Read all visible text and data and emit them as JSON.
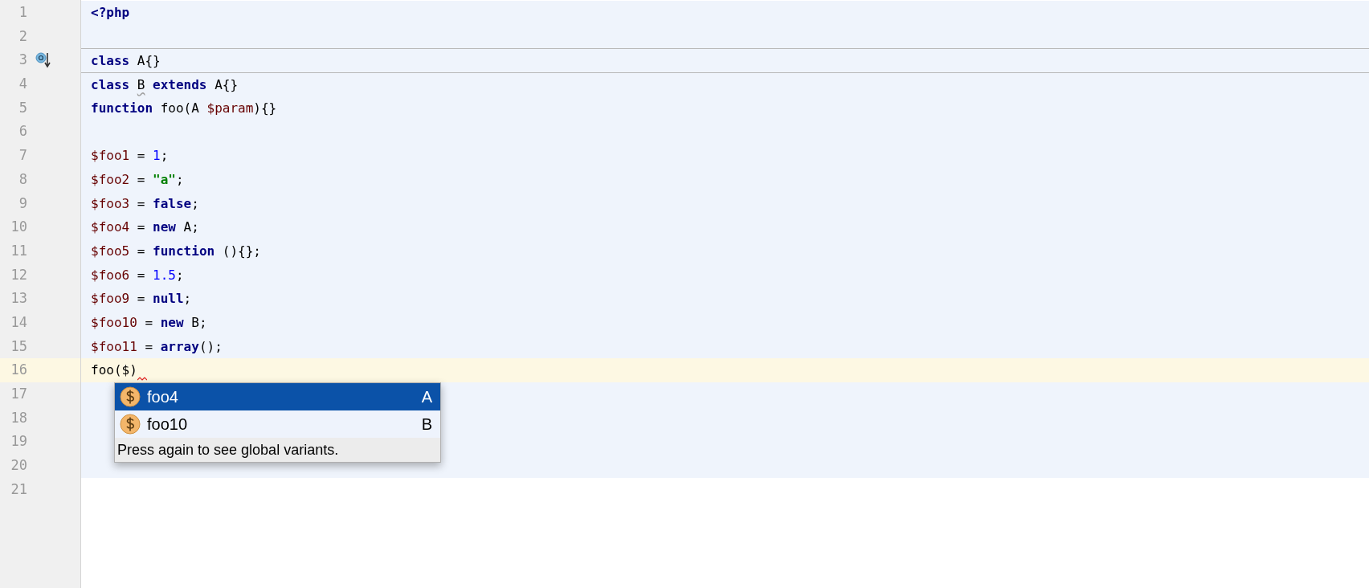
{
  "editor": {
    "lines": [
      {
        "number": "1",
        "tinted": true,
        "current": false,
        "separator_above": false,
        "error_after": false,
        "tokens": [
          {
            "kind": "keyword",
            "text": "<?php"
          }
        ]
      },
      {
        "number": "2",
        "tinted": true,
        "current": false,
        "separator_above": false,
        "error_after": false
      },
      {
        "number": "3",
        "tinted": true,
        "current": false,
        "separator_above": true,
        "error_after": false,
        "gutter_marker": {
          "kind": "implemented"
        },
        "tokens": [
          {
            "kind": "keyword",
            "text": "class"
          },
          {
            "kind": "plain",
            "text": " A{}"
          }
        ]
      },
      {
        "number": "4",
        "tinted": true,
        "current": false,
        "separator_above": true,
        "error_after": false,
        "tokens": [
          {
            "kind": "keyword",
            "text": "class "
          },
          {
            "kind": "warning",
            "text": "B"
          },
          {
            "kind": "keyword",
            "text": " extends"
          },
          {
            "kind": "plain",
            "text": " A{}"
          }
        ]
      },
      {
        "number": "5",
        "tinted": true,
        "current": false,
        "separator_above": false,
        "error_after": false,
        "tokens": [
          {
            "kind": "keyword",
            "text": "function"
          },
          {
            "kind": "plain",
            "text": " foo(A "
          },
          {
            "kind": "variable",
            "text": "$param"
          },
          {
            "kind": "plain",
            "text": "){}"
          }
        ]
      },
      {
        "number": "6",
        "tinted": true,
        "current": false,
        "separator_above": false,
        "error_after": false
      },
      {
        "number": "7",
        "tinted": true,
        "current": false,
        "separator_above": false,
        "error_after": false,
        "tokens": [
          {
            "kind": "variable",
            "text": "$foo1"
          },
          {
            "kind": "plain",
            "text": " = "
          },
          {
            "kind": "number",
            "text": "1"
          },
          {
            "kind": "plain",
            "text": ";"
          }
        ]
      },
      {
        "number": "8",
        "tinted": true,
        "current": false,
        "separator_above": false,
        "error_after": false,
        "tokens": [
          {
            "kind": "variable",
            "text": "$foo2"
          },
          {
            "kind": "plain",
            "text": " = "
          },
          {
            "kind": "string",
            "text": "\"a\""
          },
          {
            "kind": "plain",
            "text": ";"
          }
        ]
      },
      {
        "number": "9",
        "tinted": true,
        "current": false,
        "separator_above": false,
        "error_after": false,
        "tokens": [
          {
            "kind": "variable",
            "text": "$foo3"
          },
          {
            "kind": "plain",
            "text": " = "
          },
          {
            "kind": "keyword",
            "text": "false"
          },
          {
            "kind": "plain",
            "text": ";"
          }
        ]
      },
      {
        "number": "10",
        "tinted": true,
        "current": false,
        "separator_above": false,
        "error_after": false,
        "tokens": [
          {
            "kind": "variable",
            "text": "$foo4"
          },
          {
            "kind": "plain",
            "text": " = "
          },
          {
            "kind": "keyword",
            "text": "new"
          },
          {
            "kind": "plain",
            "text": " A;"
          }
        ]
      },
      {
        "number": "11",
        "tinted": true,
        "current": false,
        "separator_above": false,
        "error_after": false,
        "tokens": [
          {
            "kind": "variable",
            "text": "$foo5"
          },
          {
            "kind": "plain",
            "text": " = "
          },
          {
            "kind": "keyword",
            "text": "function"
          },
          {
            "kind": "plain",
            "text": " (){};"
          }
        ]
      },
      {
        "number": "12",
        "tinted": true,
        "current": false,
        "separator_above": false,
        "error_after": false,
        "tokens": [
          {
            "kind": "variable",
            "text": "$foo6"
          },
          {
            "kind": "plain",
            "text": " = "
          },
          {
            "kind": "number",
            "text": "1.5"
          },
          {
            "kind": "plain",
            "text": ";"
          }
        ]
      },
      {
        "number": "13",
        "tinted": true,
        "current": false,
        "separator_above": false,
        "error_after": false,
        "tokens": [
          {
            "kind": "variable",
            "text": "$foo9"
          },
          {
            "kind": "plain",
            "text": " = "
          },
          {
            "kind": "keyword",
            "text": "null"
          },
          {
            "kind": "plain",
            "text": ";"
          }
        ]
      },
      {
        "number": "14",
        "tinted": true,
        "current": false,
        "separator_above": false,
        "error_after": false,
        "tokens": [
          {
            "kind": "variable",
            "text": "$foo10"
          },
          {
            "kind": "plain",
            "text": " = "
          },
          {
            "kind": "keyword",
            "text": "new"
          },
          {
            "kind": "plain",
            "text": " B;"
          }
        ]
      },
      {
        "number": "15",
        "tinted": true,
        "current": false,
        "separator_above": false,
        "error_after": false,
        "tokens": [
          {
            "kind": "variable",
            "text": "$foo11"
          },
          {
            "kind": "plain",
            "text": " = "
          },
          {
            "kind": "keyword",
            "text": "array"
          },
          {
            "kind": "plain",
            "text": "();"
          }
        ]
      },
      {
        "number": "16",
        "tinted": true,
        "current": true,
        "separator_above": false,
        "error_after": true,
        "tokens": [
          {
            "kind": "plain",
            "text": "foo($)"
          }
        ]
      },
      {
        "number": "17",
        "tinted": true,
        "current": false,
        "separator_above": false,
        "error_after": false
      },
      {
        "number": "18",
        "tinted": true,
        "current": false,
        "separator_above": false,
        "error_after": false
      },
      {
        "number": "19",
        "tinted": true,
        "current": false,
        "separator_above": false,
        "error_after": false
      },
      {
        "number": "20",
        "tinted": true,
        "current": false,
        "separator_above": false,
        "error_after": false
      },
      {
        "number": "21",
        "tinted": false,
        "current": false,
        "separator_above": false,
        "error_after": false
      }
    ]
  },
  "completion_popup": {
    "items": [
      {
        "name": "foo4",
        "type": "A",
        "selected": true
      },
      {
        "name": "foo10",
        "type": "B",
        "selected": false
      }
    ],
    "hint": "Press again to see global variants."
  }
}
